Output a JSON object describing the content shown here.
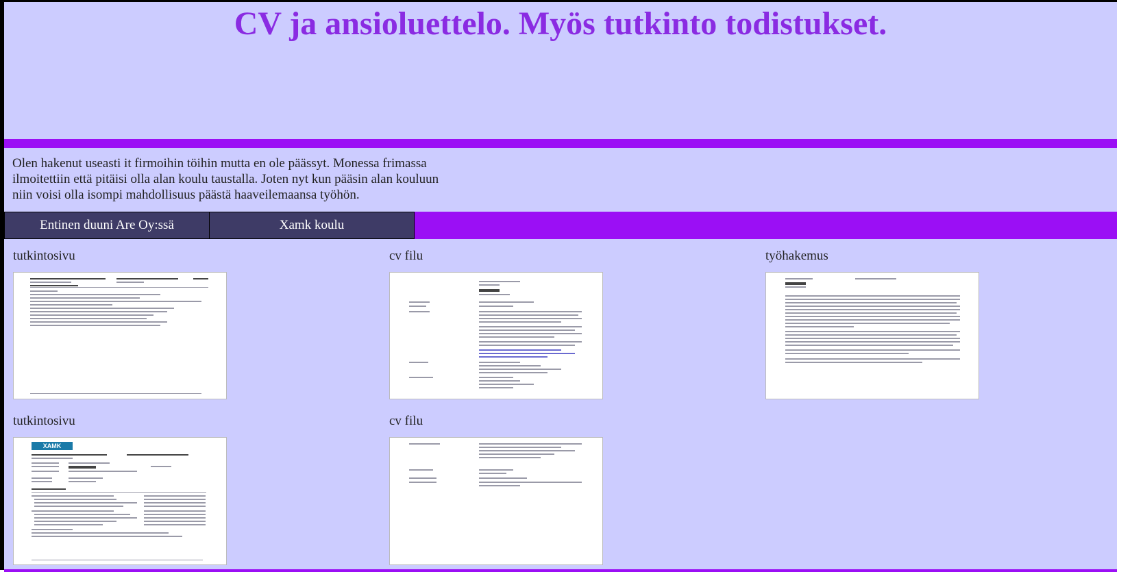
{
  "header": {
    "title": "CV ja ansioluettelo. Myös tutkinto todistukset."
  },
  "intro": {
    "text": "Olen hakenut useasti it firmoihin töihin mutta en ole päässyt. Monessa frimassa ilmoitettiin että pitäisi olla alan koulu taustalla. Joten nyt kun pääsin alan kouluun niin voisi olla isompi mahdollisuus päästä haaveilemaansa työhön."
  },
  "nav": {
    "items": [
      {
        "label": "Entinen duuni Are Oy:ssä"
      },
      {
        "label": "Xamk koulu"
      }
    ]
  },
  "gallery": {
    "items": [
      {
        "label": "tutkintosivu"
      },
      {
        "label": "cv filu"
      },
      {
        "label": "työhakemus"
      },
      {
        "label": "tutkintosivu",
        "logo": "XAMK"
      },
      {
        "label": "cv filu"
      }
    ]
  },
  "colors": {
    "background": "#ccccff",
    "accent": "#9b0ff5",
    "title": "#8a2be2",
    "nav_button": "#3e3b66"
  }
}
